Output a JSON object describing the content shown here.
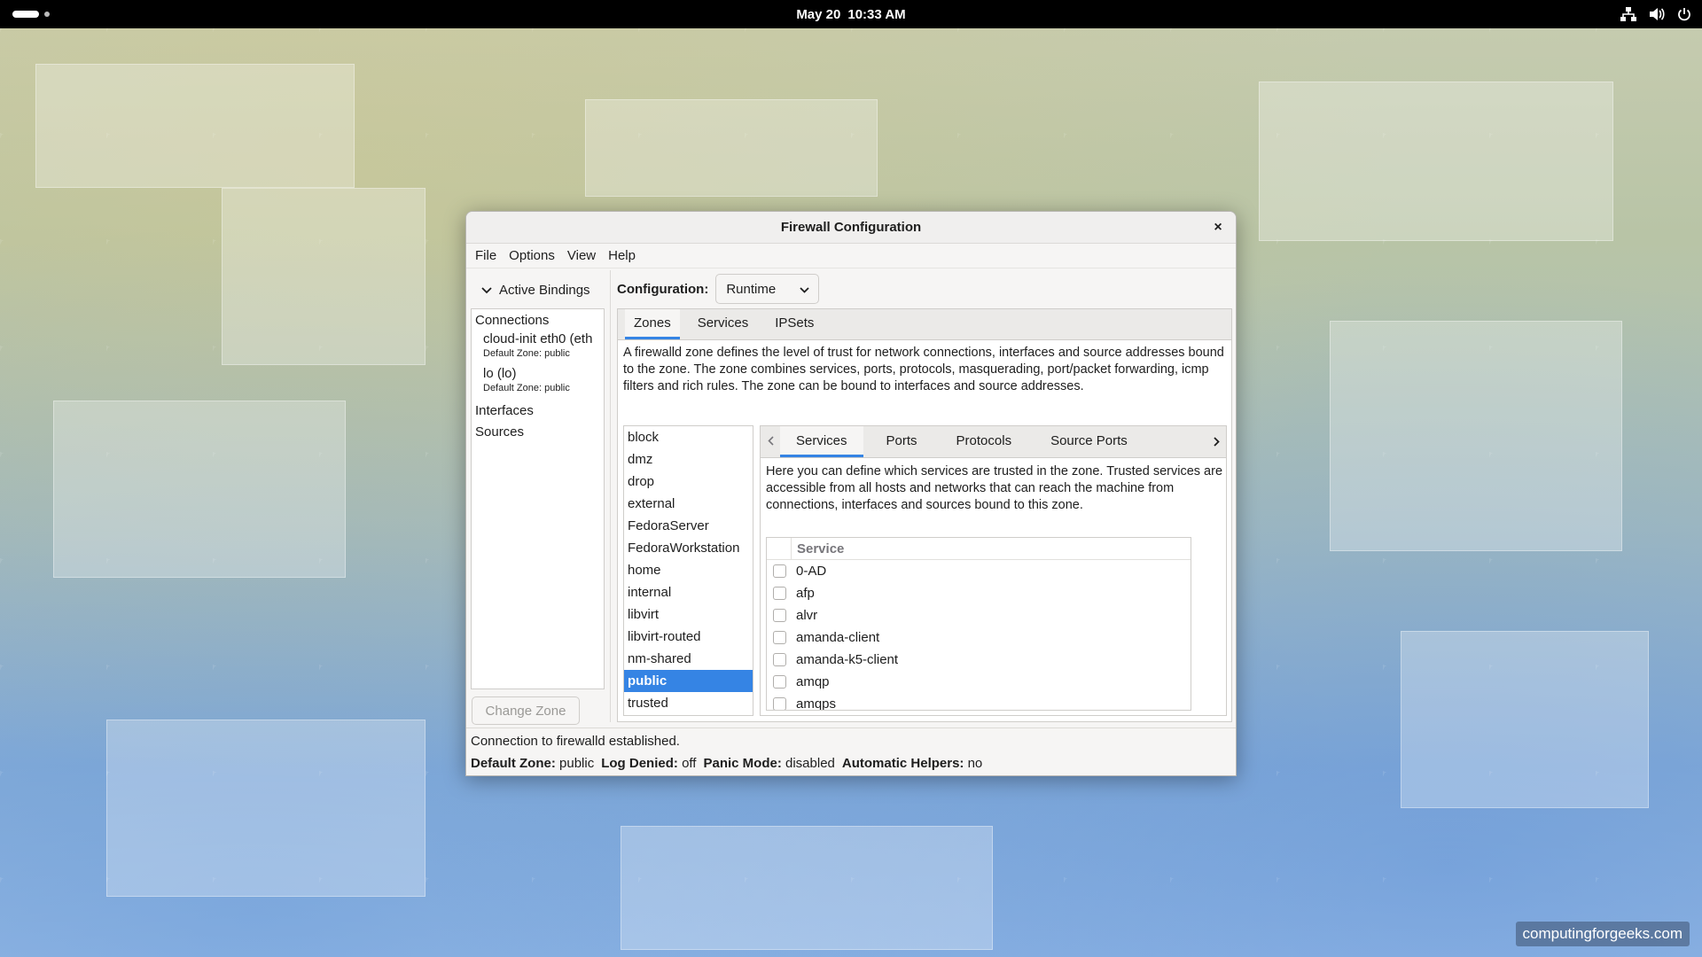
{
  "topbar": {
    "date": "May 20",
    "time": "10:33 AM"
  },
  "window": {
    "title": "Firewall Configuration",
    "close": "×"
  },
  "menu": [
    "File",
    "Options",
    "View",
    "Help"
  ],
  "bindings": {
    "header": "Active Bindings",
    "connections_label": "Connections",
    "connections": [
      {
        "name": "cloud-init eth0 (eth",
        "zone": "Default Zone: public"
      },
      {
        "name": "lo (lo)",
        "zone": "Default Zone: public"
      }
    ],
    "interfaces_label": "Interfaces",
    "sources_label": "Sources",
    "change_zone": "Change Zone"
  },
  "config": {
    "label": "Configuration:",
    "value": "Runtime"
  },
  "tabs": [
    "Zones",
    "Services",
    "IPSets"
  ],
  "zone_description": "A firewalld zone defines the level of trust for network connections, interfaces and source addresses bound to the zone. The zone combines services, ports, protocols, masquerading, port/packet forwarding, icmp filters and rich rules. The zone can be bound to interfaces and source addresses.",
  "zones": [
    "block",
    "dmz",
    "drop",
    "external",
    "FedoraServer",
    "FedoraWorkstation",
    "home",
    "internal",
    "libvirt",
    "libvirt-routed",
    "nm-shared",
    "public",
    "trusted"
  ],
  "selected_zone": "public",
  "inner_tabs": [
    "Services",
    "Ports",
    "Protocols",
    "Source Ports"
  ],
  "services_description": "Here you can define which services are trusted in the zone. Trusted services are accessible from all hosts and networks that can reach the machine from connections, interfaces and sources bound to this zone.",
  "services_header": "Service",
  "services": [
    "0-AD",
    "afp",
    "alvr",
    "amanda-client",
    "amanda-k5-client",
    "amqp",
    "amqps"
  ],
  "status": {
    "message": "Connection to firewalld established.",
    "default_zone_label": "Default Zone:",
    "default_zone": "public",
    "log_denied_label": "Log Denied:",
    "log_denied": "off",
    "panic_label": "Panic Mode:",
    "panic": "disabled",
    "helpers_label": "Automatic Helpers:",
    "helpers": "no"
  },
  "watermark": "computingforgeeks.com",
  "colors": {
    "accent": "#3584e4",
    "topbar": "#000000"
  }
}
